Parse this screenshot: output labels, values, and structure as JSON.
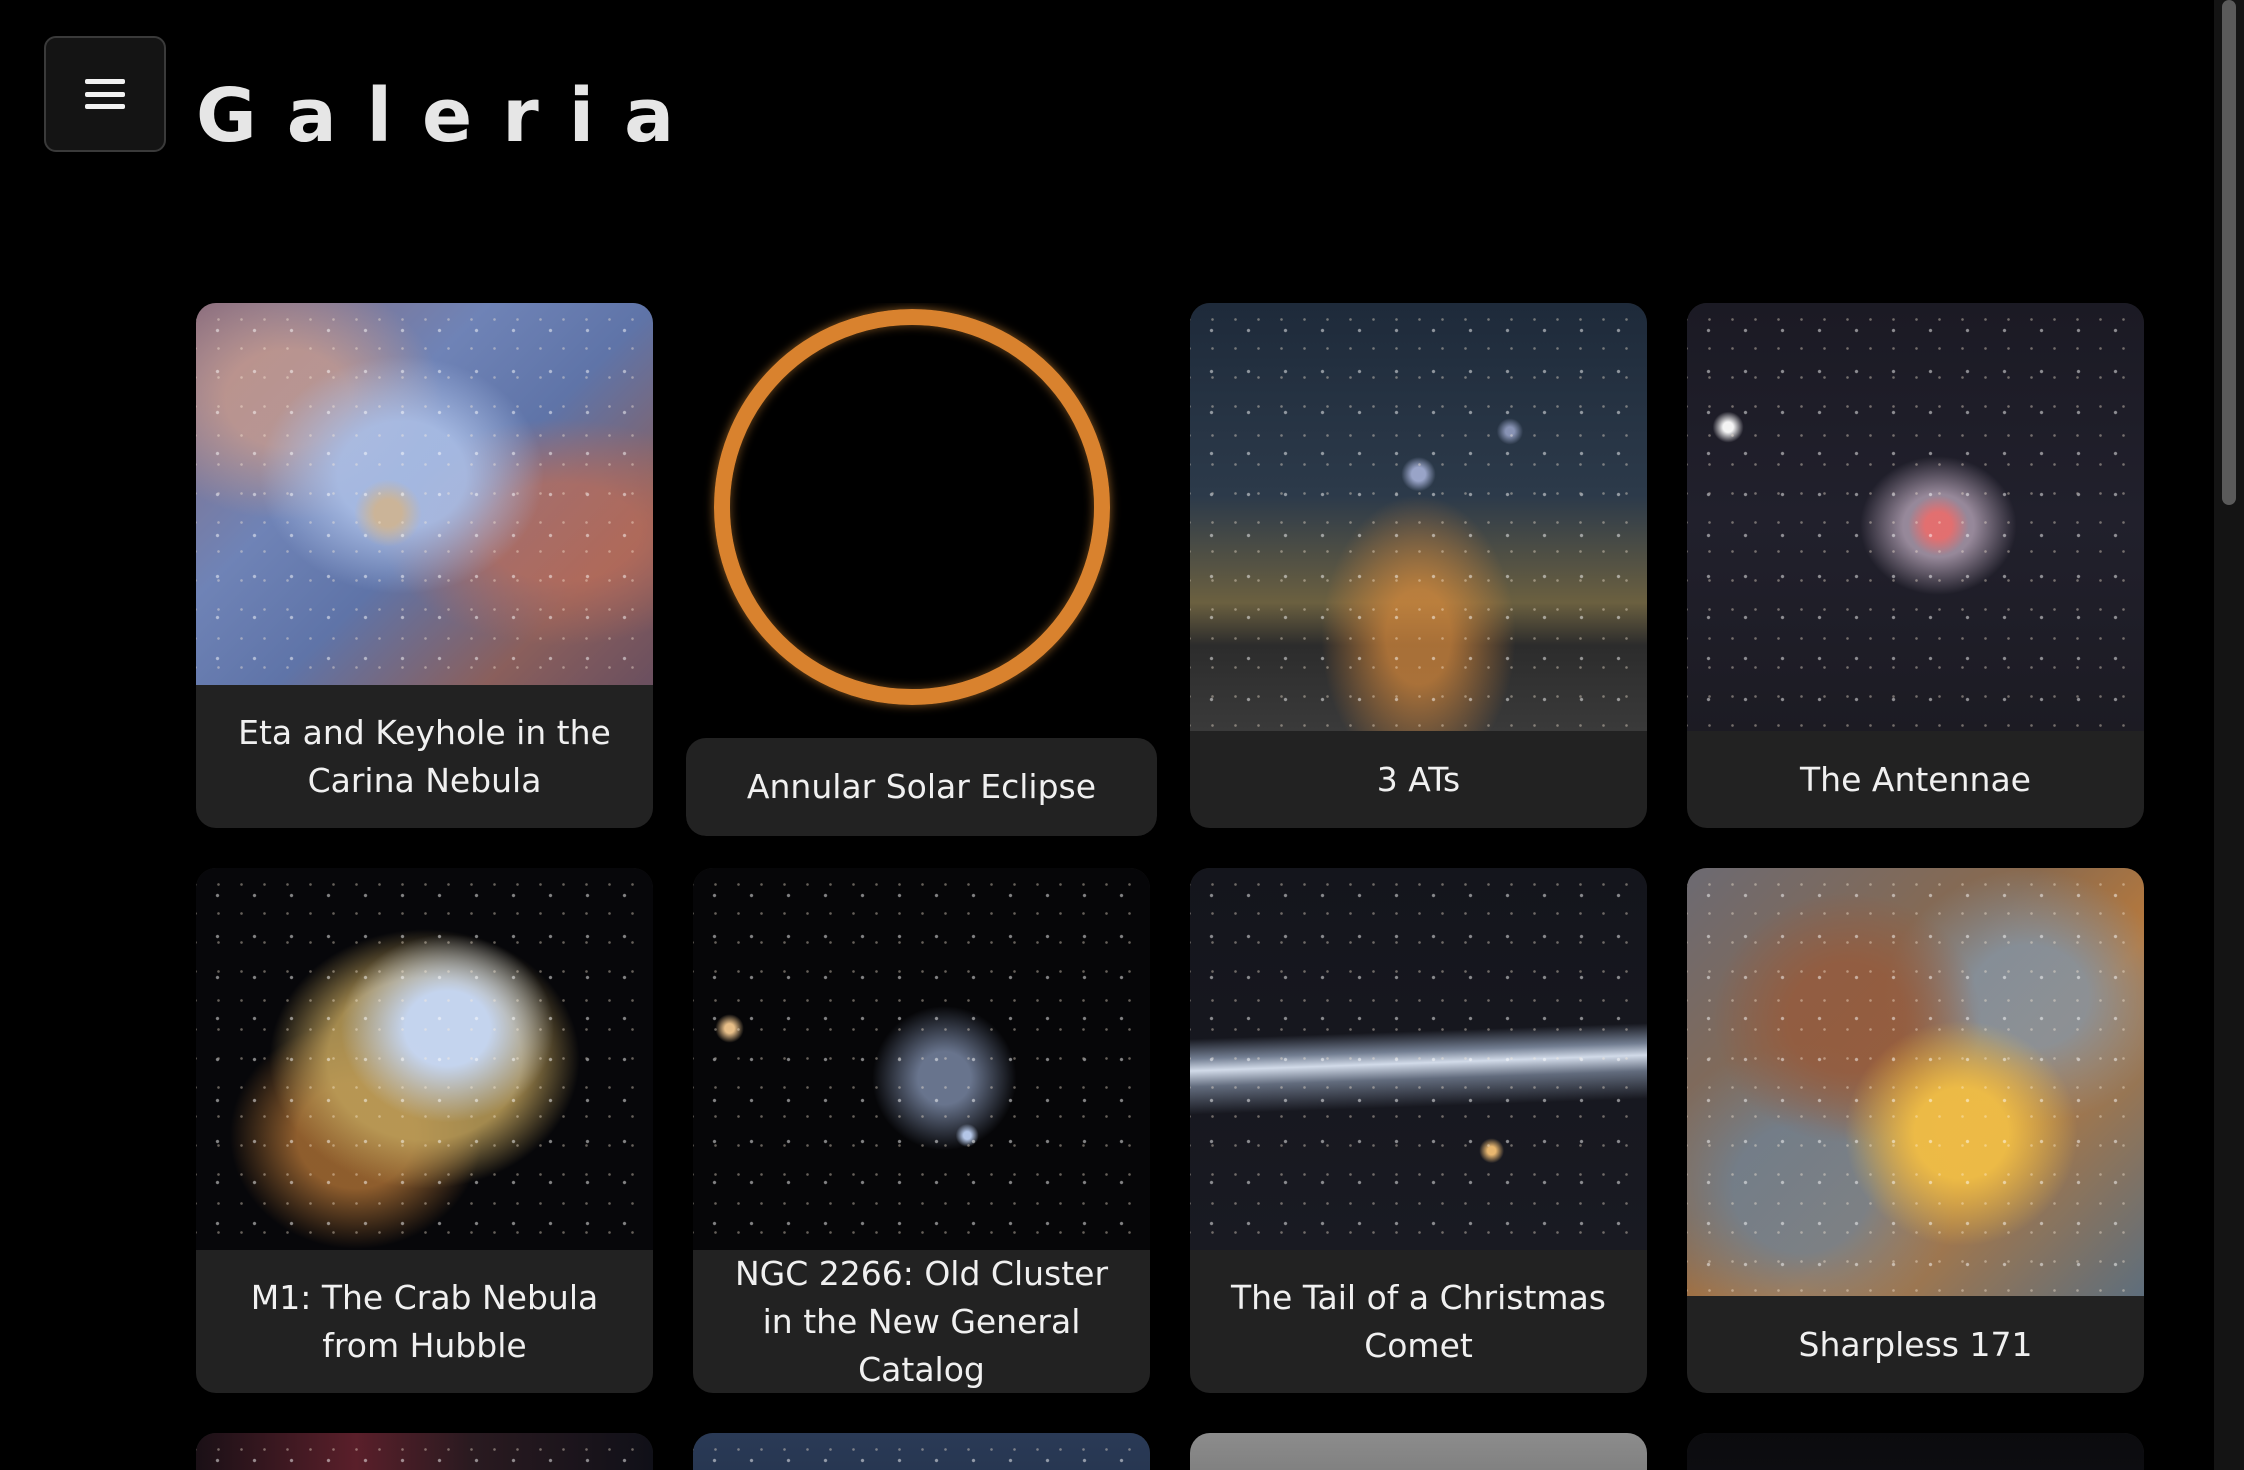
{
  "header": {
    "title": "Galeria",
    "menu_icon": "hamburger-menu-icon"
  },
  "gallery": {
    "items": [
      {
        "caption": "Eta and Keyhole in the Carina Nebula"
      },
      {
        "caption": "Annular Solar Eclipse"
      },
      {
        "caption": "3 ATs"
      },
      {
        "caption": "The Antennae"
      },
      {
        "caption": "M1: The Crab Nebula from Hubble"
      },
      {
        "caption": "NGC 2266: Old Cluster in the New General Catalog"
      },
      {
        "caption": "The Tail of a Christmas Comet"
      },
      {
        "caption": "Sharpless 171"
      }
    ]
  },
  "colors": {
    "background": "#000000",
    "card_background": "#222222",
    "text": "#f0f0f0",
    "eclipse_ring": "#d9822e"
  }
}
